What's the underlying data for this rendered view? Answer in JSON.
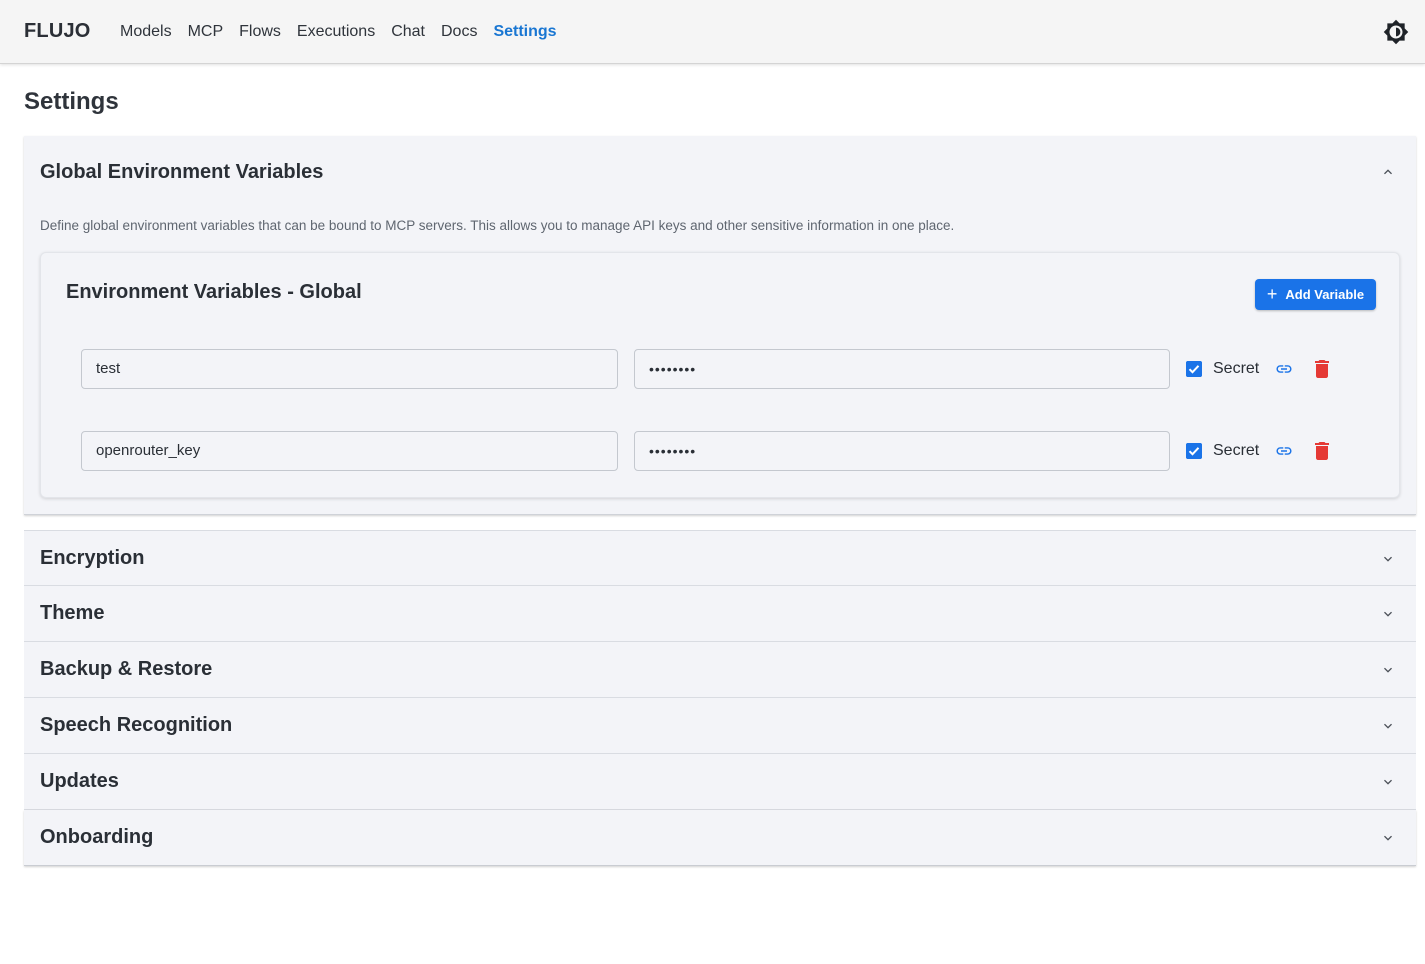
{
  "app": {
    "brand": "FLUJO"
  },
  "nav": {
    "items": [
      {
        "label": "Models",
        "active": false
      },
      {
        "label": "MCP",
        "active": false
      },
      {
        "label": "Flows",
        "active": false
      },
      {
        "label": "Executions",
        "active": false
      },
      {
        "label": "Chat",
        "active": false
      },
      {
        "label": "Docs",
        "active": false
      },
      {
        "label": "Settings",
        "active": true
      }
    ],
    "theme_toggle_icon": "brightness-icon"
  },
  "page": {
    "title": "Settings"
  },
  "global_env": {
    "title": "Global Environment Variables",
    "expanded": true,
    "description": "Define global environment variables that can be bound to MCP servers. This allows you to manage API keys and other sensitive information in one place.",
    "card_title": "Environment Variables - Global",
    "add_button_label": "Add Variable",
    "variables": [
      {
        "name": "test",
        "value_masked": "••••••••",
        "secret": true,
        "secret_label": "Secret"
      },
      {
        "name": "openrouter_key",
        "value_masked": "••••••••",
        "secret": true,
        "secret_label": "Secret"
      }
    ]
  },
  "sections": [
    {
      "title": "Encryption",
      "expanded": false
    },
    {
      "title": "Theme",
      "expanded": false
    },
    {
      "title": "Backup & Restore",
      "expanded": false
    },
    {
      "title": "Speech Recognition",
      "expanded": false
    },
    {
      "title": "Updates",
      "expanded": false
    },
    {
      "title": "Onboarding",
      "expanded": false
    }
  ],
  "colors": {
    "accent": "#1976d2",
    "button": "#1a73e8",
    "danger": "#e53935",
    "panel_bg": "#f3f4f8"
  }
}
